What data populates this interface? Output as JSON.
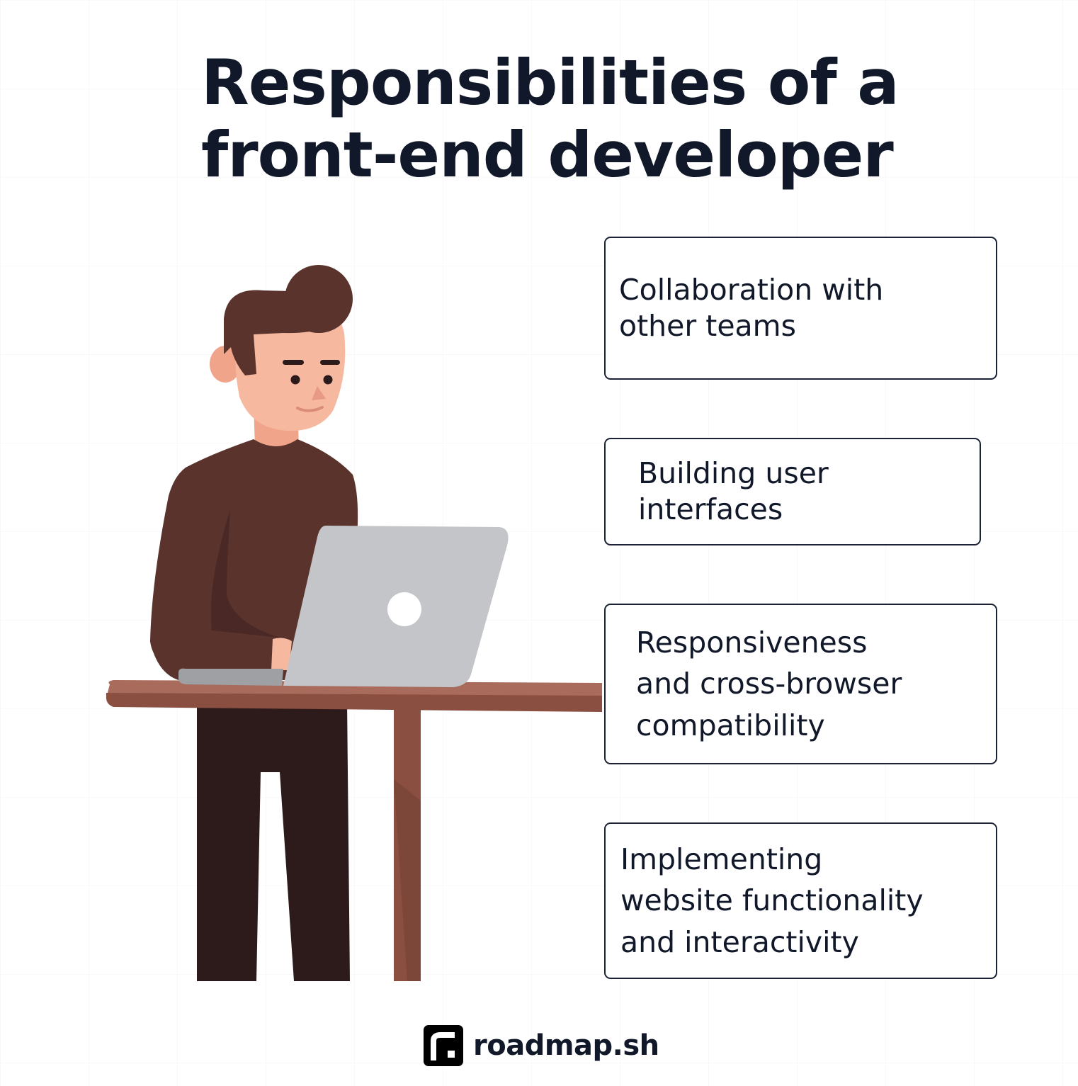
{
  "title": {
    "line1": "Responsibilities of a",
    "line2": "front-end developer"
  },
  "responsibilities": [
    {
      "line1": "Collaboration with",
      "line2": "other teams"
    },
    {
      "line1": "Building user",
      "line2": "interfaces"
    },
    {
      "line1": "Responsiveness",
      "line2": "and cross-browser",
      "line3": "compatibility"
    },
    {
      "line1": "Implementing",
      "line2": "website functionality",
      "line3": "and interactivity"
    }
  ],
  "brand": {
    "name": "roadmap.sh",
    "logo_icon": "roadmap-logo-icon"
  },
  "illustration": {
    "subject": "developer-at-laptop-illustration"
  },
  "colors": {
    "text": "#101829",
    "border": "#1b2233",
    "hair": "#5a332c",
    "skin": "#f7b8a0",
    "sweater": "#5a332c",
    "pants": "#2d1b1b",
    "table": "#a86b5c",
    "laptop": "#c4c5c8"
  }
}
